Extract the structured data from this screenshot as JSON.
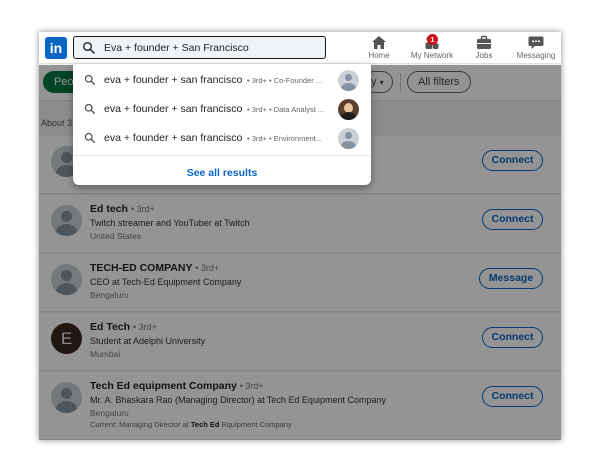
{
  "header": {
    "logo_text": "in",
    "search": {
      "value": "Eva + founder + San Francisco",
      "placeholder": "Search"
    },
    "nav": [
      {
        "label": "Home",
        "icon": "home-icon"
      },
      {
        "label": "My Network",
        "icon": "my-network-icon",
        "badge": "1"
      },
      {
        "label": "Jobs",
        "icon": "jobs-icon"
      },
      {
        "label": "Messaging",
        "icon": "messaging-icon"
      }
    ]
  },
  "filters": {
    "people_label": "Peop",
    "dropdown_label": "y",
    "all_filters_label": "All filters"
  },
  "results_count_text": "About 3",
  "suggestions": [
    {
      "query": "eva + founder + san francisco",
      "detail": "• 3rd+ • Co-Founder ...",
      "avatar": "default"
    },
    {
      "query": "eva + founder + san francisco",
      "detail": "• 3rd+ • Data Analyst ...",
      "avatar": "photo"
    },
    {
      "query": "eva + founder + san francisco",
      "detail": "• 3rd+ • Environment...",
      "avatar": "default"
    }
  ],
  "see_all_label": "See all results",
  "results": [
    {
      "name": "",
      "degree": "",
      "headline": "",
      "location": "",
      "action": "Connect"
    },
    {
      "name": "Ed tech",
      "degree": "• 3rd+",
      "headline": "Twitch streamer and YouTuber at Twitch",
      "location": "United States",
      "action": "Connect"
    },
    {
      "name": "TECH-ED COMPANY",
      "degree": "• 3rd+",
      "headline": "CEO at Tech-Ed Equipment Company",
      "location": "Bengaluru",
      "action": "Message"
    },
    {
      "name": "Ed Tech",
      "degree": "• 3rd+",
      "headline": "Student at Adelphi University",
      "location": "Mumbai",
      "action": "Connect",
      "avatar_letter": "E"
    },
    {
      "name": "Tech Ed equipment Company",
      "degree": "• 3rd+",
      "headline": "Mr. A. Bhaskara Rao (Managing Director) at Tech Ed Equipment Company",
      "location": "Bengaluru",
      "action": "Connect",
      "current_prefix": "Current: Managing Director at ",
      "current_bold": "Tech Ed",
      "current_suffix": " Equipment Company"
    }
  ],
  "colors": {
    "brand": "#0a66c2",
    "people_pill": "#057642",
    "badge": "#cc1016"
  }
}
